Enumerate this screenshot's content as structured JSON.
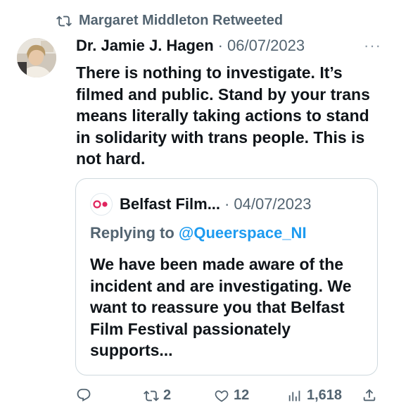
{
  "retweet": {
    "label": "Margaret Middleton Retweeted",
    "icon": "retweet-icon"
  },
  "tweet": {
    "author_name": "Dr. Jamie J. Hagen",
    "separator": "·",
    "date": "06/07/2023",
    "more_icon": "···",
    "text": "There is nothing to investigate. It’s filmed and public. Stand by your trans means literally taking actions to stand in solidarity with trans people. This is not hard."
  },
  "quote": {
    "logo_icon": "belfast-film-festival-logo",
    "name": "Belfast Film...",
    "separator": "·",
    "date": "04/07/2023",
    "replying_prefix": "Replying to",
    "replying_handle": "@Queerspace_NI",
    "text": "We have been made aware of the incident and are investigating. We want to reassure you that Belfast Film Festival passionately supports..."
  },
  "actions": {
    "reply_count": "",
    "retweet_count": "2",
    "like_count": "12",
    "views_count": "1,618"
  },
  "colors": {
    "secondary": "#536471",
    "link": "#1d9bf0",
    "logo_red": "#e0245e",
    "border": "#cfd9de"
  }
}
